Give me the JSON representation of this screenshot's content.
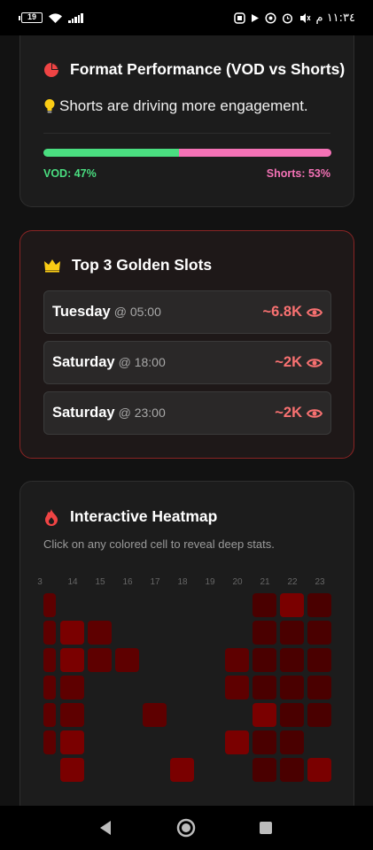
{
  "status_bar": {
    "battery": "19",
    "time": "١١:٣٤ م"
  },
  "format_card": {
    "title": "Format Performance (VOD vs Shorts)",
    "icon": "pie-chart-icon",
    "insight_icon": "lightbulb-icon",
    "insight": "Shorts are driving more engagement.",
    "vod_label": "VOD: 47%",
    "shorts_label": "Shorts: 53%",
    "vod_share": 0.47,
    "shorts_share": 0.53,
    "colors": {
      "vod": "#4ade80",
      "shorts": "#f472b6"
    }
  },
  "golden_card": {
    "title": "Top 3 Golden Slots",
    "icon": "crown-icon",
    "slots": [
      {
        "day": "Tuesday",
        "time": "@ 05:00",
        "views": "~6.8K"
      },
      {
        "day": "Saturday",
        "time": "@ 18:00",
        "views": "~2K"
      },
      {
        "day": "Saturday",
        "time": "@ 23:00",
        "views": "~2K"
      }
    ]
  },
  "heat_card": {
    "title": "Interactive Heatmap",
    "icon": "fire-icon",
    "subtitle": "Click on any colored cell to reveal deep stats.",
    "hours": [
      "3",
      "14",
      "15",
      "16",
      "17",
      "18",
      "19",
      "20",
      "21",
      "22",
      "23"
    ],
    "intensity_levels": {
      "1": "#4a0000",
      "2": "#5e0000",
      "3": "#7a0000",
      "4": "#8f0000"
    },
    "rows": [
      [
        2,
        0,
        0,
        0,
        0,
        0,
        0,
        0,
        1,
        3,
        1
      ],
      [
        2,
        3,
        2,
        0,
        0,
        0,
        0,
        0,
        1,
        1,
        1
      ],
      [
        2,
        3,
        2,
        2,
        0,
        0,
        0,
        2,
        1,
        1,
        1
      ],
      [
        2,
        2,
        0,
        0,
        0,
        0,
        0,
        2,
        1,
        1,
        1
      ],
      [
        2,
        2,
        0,
        0,
        2,
        0,
        0,
        0,
        3,
        1,
        1
      ],
      [
        2,
        3,
        0,
        0,
        0,
        0,
        0,
        3,
        1,
        1,
        0
      ],
      [
        0,
        3,
        0,
        0,
        0,
        3,
        0,
        0,
        1,
        1,
        3
      ]
    ]
  },
  "nav": {
    "back_icon": "back-triangle-icon",
    "home_icon": "home-circle-icon",
    "recents_icon": "recents-square-icon"
  }
}
